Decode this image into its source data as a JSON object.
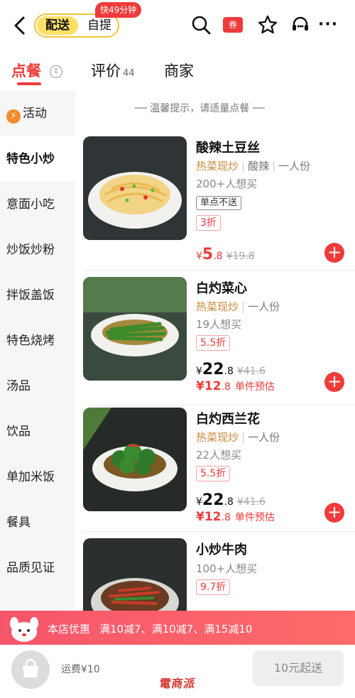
{
  "header": {
    "mode_active": "配送",
    "mode_inactive": "自提",
    "speed_badge": "快49分钟",
    "coupon_icon_text": "券",
    "more_icon_text": "···"
  },
  "tabs": [
    {
      "label": "点餐",
      "active": true
    },
    {
      "label": "评价",
      "count": "44"
    },
    {
      "label": "商家"
    }
  ],
  "tab_switch_icon_text": "⇧",
  "categories": [
    {
      "label": "活动",
      "icon": "flash-icon"
    },
    {
      "label": "特色小炒",
      "active": true
    },
    {
      "label": "意面小吃"
    },
    {
      "label": "炒饭炒粉"
    },
    {
      "label": "拌饭盖饭"
    },
    {
      "label": "特色烧烤"
    },
    {
      "label": "汤品"
    },
    {
      "label": "饮品"
    },
    {
      "label": "单加米饭"
    },
    {
      "label": "餐具"
    },
    {
      "label": "品质见证"
    }
  ],
  "tip": "── 温馨提示，请适量点餐 ──",
  "items": [
    {
      "name": "酸辣土豆丝",
      "tag_hot": "热菜现炒",
      "tags": [
        "酸辣",
        "一人份"
      ],
      "wants": "200+人想买",
      "badge": "单点不送",
      "discount": "3折",
      "price_currency": "¥",
      "price_int": "5",
      "price_dec": ".8",
      "orig_price": "¥19.8"
    },
    {
      "name": "白灼菜心",
      "tag_hot": "热菜现炒",
      "tags": [
        "一人份"
      ],
      "wants": "19人想买",
      "discount": "5.5折",
      "price_currency": "¥",
      "price_int": "22",
      "price_dec": ".8",
      "orig_price": "¥41.6",
      "est_int": "¥12",
      "est_dec": ".8",
      "est_label": "单件预估"
    },
    {
      "name": "白灼西兰花",
      "tag_hot": "热菜现炒",
      "tags": [
        "一人份"
      ],
      "wants": "22人想买",
      "discount": "5.5折",
      "price_currency": "¥",
      "price_int": "22",
      "price_dec": ".8",
      "orig_price": "¥41.6",
      "est_int": "¥12",
      "est_dec": ".8",
      "est_label": "单件预估"
    },
    {
      "name": "小炒牛肉",
      "wants": "100+人想买",
      "discount": "9.7折"
    }
  ],
  "add_icon_text": "+",
  "promo": {
    "title": "本店优惠",
    "offers": "满10减7、满10减7、满15减10"
  },
  "bottom": {
    "fee": "运费¥10",
    "min_order": "10元起送",
    "watermark": "電商派"
  },
  "colors": {
    "accent_red": "#ef3b3b",
    "mode_yellow": "#ffe066",
    "tag_orange": "#c8883a"
  }
}
